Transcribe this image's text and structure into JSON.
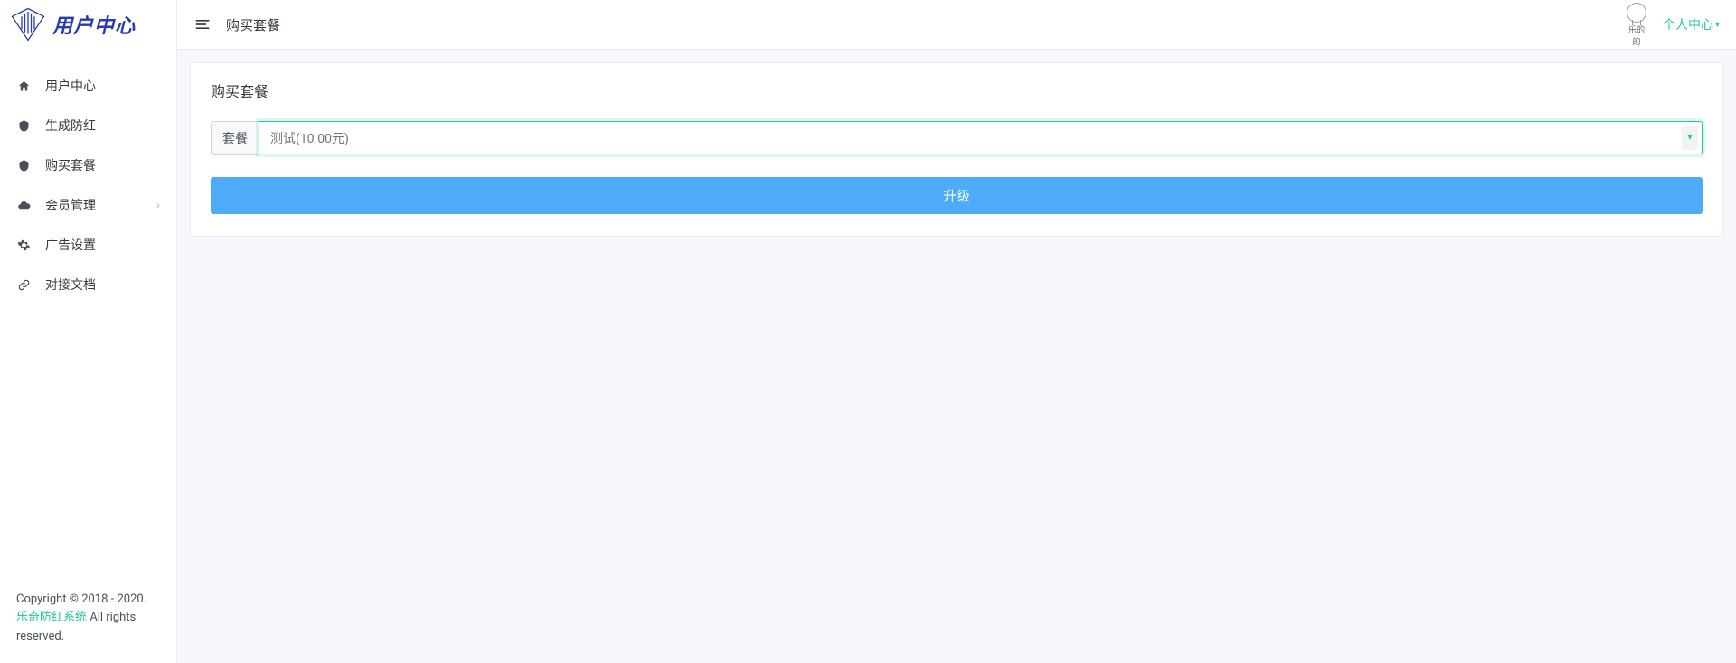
{
  "brand": {
    "name": "用户中心"
  },
  "sidebar": {
    "items": [
      {
        "label": "用户中心"
      },
      {
        "label": "生成防红"
      },
      {
        "label": "购买套餐"
      },
      {
        "label": "会员管理"
      },
      {
        "label": "广告设置"
      },
      {
        "label": "对接文档"
      }
    ],
    "footer": {
      "copyright_prefix": "Copyright © 2018 - 2020. ",
      "link": "乐奇防红系统",
      "suffix": " All rights reserved."
    }
  },
  "topbar": {
    "title": "购买套餐",
    "avatar_label": "乐的的",
    "user_menu": "个人中心"
  },
  "card": {
    "title": "购买套餐",
    "select_label": "套餐",
    "select_value": "测试(10.00元)",
    "submit_label": "升级"
  }
}
